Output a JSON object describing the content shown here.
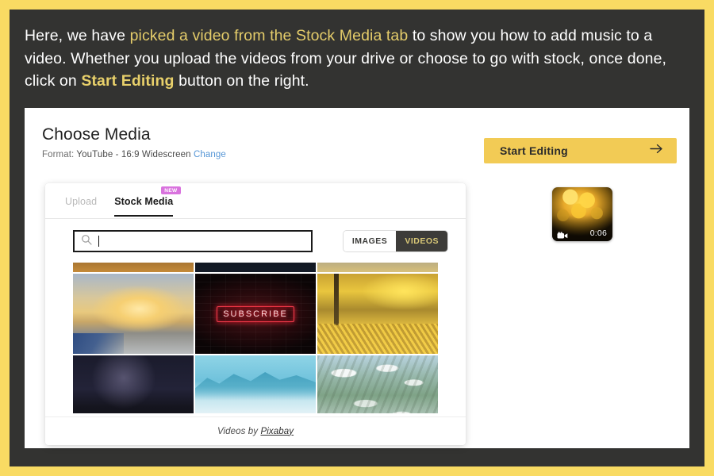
{
  "caption": {
    "part1": "Here, we have ",
    "highlight1": "picked a video from the Stock Media tab",
    "part2": " to show you how to add music to a video. Whether you upload the videos from your drive or choose to go with stock, once done, click on ",
    "highlight2": "Start Editing",
    "part3": " button on the right."
  },
  "app": {
    "title": "Choose Media",
    "format_label": "Format:",
    "format_value": "YouTube - 16:9 Widescreen",
    "change_link": "Change",
    "start_button": {
      "label": "Start Editing",
      "icon": "arrow-right-icon",
      "bg_color": "#F2CB55"
    },
    "selected_media": {
      "duration": "0:06",
      "icon": "video-camera-icon",
      "alt": "autumn-leaves-video-thumbnail"
    }
  },
  "modal": {
    "tabs": [
      {
        "label": "Upload",
        "active": false,
        "badge": null
      },
      {
        "label": "Stock Media",
        "active": true,
        "badge": "NEW"
      }
    ],
    "badge_color": "#D973DE",
    "search": {
      "value": "",
      "placeholder": "",
      "icon": "search-icon"
    },
    "toggle": {
      "options": [
        "IMAGES",
        "VIDEOS"
      ],
      "selected": "VIDEOS",
      "selected_bg": "#3D3C39",
      "selected_fg": "#D9C877"
    },
    "grid": {
      "clipped_row": [
        {
          "name": "clipped-thumb-1",
          "art": "art-clip-a"
        },
        {
          "name": "clipped-thumb-2",
          "art": "art-clip-b"
        },
        {
          "name": "clipped-thumb-3",
          "art": "art-clip-c"
        }
      ],
      "items": [
        {
          "name": "ocean-sunset-video",
          "art": "art-sunset",
          "caption": ""
        },
        {
          "name": "subscribe-neon-video",
          "art": "art-brick",
          "caption": "SUBSCRIBE"
        },
        {
          "name": "autumn-leaves-video",
          "art": "art-autumn",
          "caption": ""
        },
        {
          "name": "night-sky-mountains-video",
          "art": "art-night",
          "caption": ""
        },
        {
          "name": "foggy-mountains-video",
          "art": "art-fog",
          "caption": ""
        },
        {
          "name": "aerial-landscape-video",
          "art": "art-aerial",
          "caption": ""
        }
      ]
    },
    "footer": {
      "text": "Videos by ",
      "link": "Pixabay"
    }
  },
  "theme": {
    "frame": "#F9DB63",
    "panel": "#333331",
    "accent": "#E8D06A",
    "link": "#5596d6"
  }
}
